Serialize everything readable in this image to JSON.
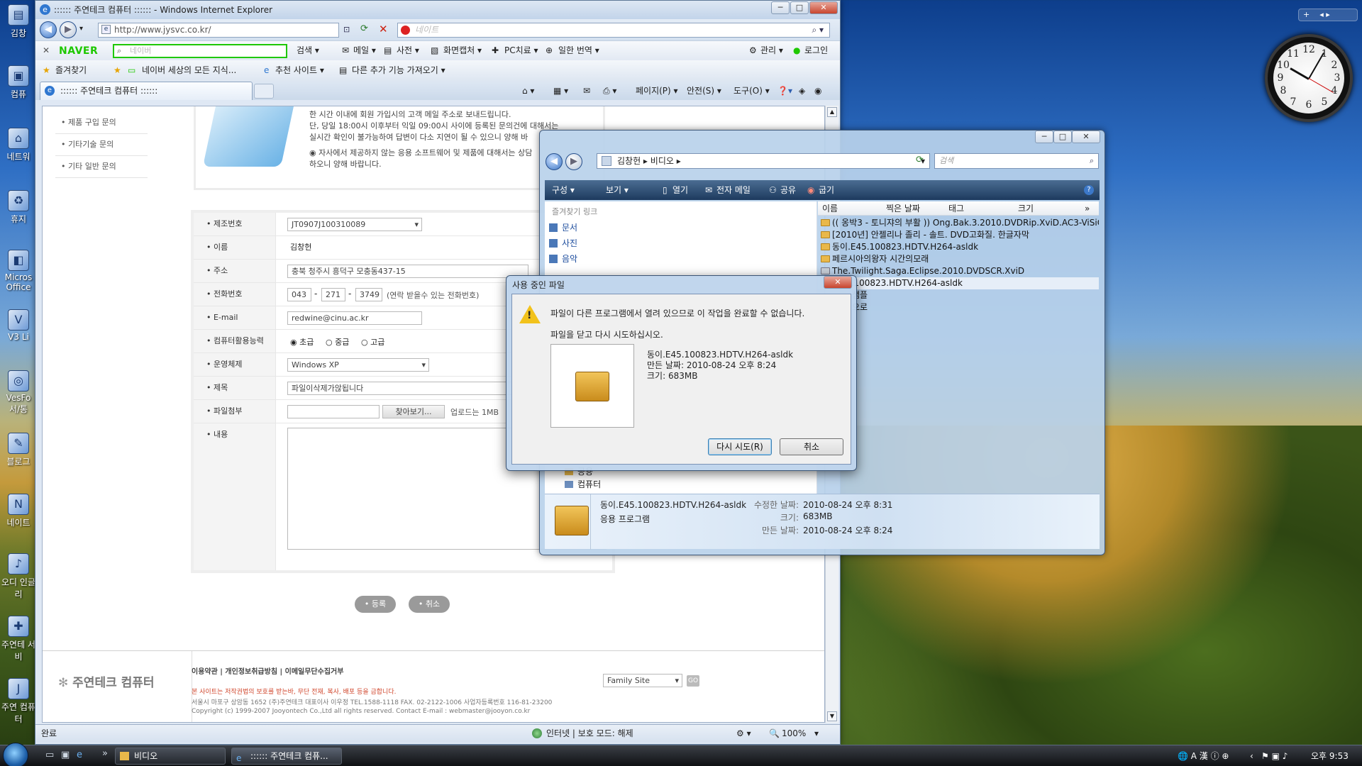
{
  "desktop": {
    "icons": [
      "김창",
      "컴퓨",
      "네트워",
      "휴지",
      "Micros Office",
      "V3 Li",
      "VesFo 서/통",
      "블로그",
      "네이트",
      "오디 인글리",
      "주연테 서비",
      "주연 컴퓨터"
    ]
  },
  "clock": {
    "numbers": [
      "12",
      "1",
      "2",
      "3",
      "4",
      "5",
      "6",
      "7",
      "8",
      "9",
      "10",
      "11"
    ]
  },
  "ie": {
    "title": ":::::: 주연테크 컴퓨터 :::::: - Windows Internet Explorer",
    "buttons": {
      "min": "─",
      "max": "□",
      "close": "✕"
    },
    "address": "http://www.jysvc.co.kr/",
    "search_placeholder": "네이트",
    "naver": {
      "logo": "NAVER",
      "placeholder": "네이버",
      "items": [
        "검색 ▾",
        "메일 ▾",
        "사전 ▾",
        "화면캡처 ▾",
        "PC치료 ▾",
        "일한 번역 ▾",
        "관리 ▾",
        "로그인"
      ]
    },
    "favorites": {
      "label": "즐겨찾기",
      "items": [
        "네이버 세상의 모든 지식...",
        "추천 사이트 ▾",
        "다른 추가 기능 가져오기 ▾"
      ]
    },
    "tab": ":::::: 주연테크 컴퓨터 ::::::",
    "commands": [
      "페이지(P) ▾",
      "안전(S) ▾",
      "도구(O) ▾"
    ],
    "status": {
      "left": "완료",
      "zone": "인터넷 | 보호 모드: 해제",
      "zoom": "100%"
    }
  },
  "page": {
    "left_nav": [
      "• 제품 구입 문의",
      "• 기타기술 문의",
      "• 기타 일반 문의"
    ],
    "notice": [
      "한 시간 이내에 회원 가입시의 고객 메일 주소로 보내드립니다.",
      "단, 당일 18:00시 이후부터 익일 09:00시 사이에 등록된 문의건에 대해서는",
      "실시간 확인이 불가능하여 답변이 다소 지연이 될 수 있으니 양해 바",
      "자사에서 제공하지 않는 응용 소프트웨어 및 제품에 대해서는 상담",
      "하오니 양해 바랍니다."
    ],
    "form": {
      "labels": [
        "• 제조번호",
        "• 이름",
        "• 주소",
        "• 전화번호",
        "• E-mail",
        "• 컴퓨터활용능력",
        "• 운영체제",
        "• 제목",
        "• 파일첨부",
        "• 내용"
      ],
      "serial": "JT0907J100310089",
      "name": "김창헌",
      "address": "충북 청주시 흥덕구 모충동437-15",
      "phone": [
        "043",
        "271",
        "3749"
      ],
      "phone_note": "(연락 받을수 있는 전화번호)",
      "email": "redwine@cinu.ac.kr",
      "skill": [
        "초급",
        "중급",
        "고급"
      ],
      "os": "Windows XP",
      "subject": "파일이삭제가않됩니다",
      "browse": "찾아보기...",
      "upload_note": "업로드는 1MB"
    },
    "buttons": {
      "submit": "• 등록",
      "cancel": "• 취소"
    },
    "footer": {
      "logo": "주연테크 컴퓨터",
      "links": "이용약관 | 개인정보취급방침 | 이메일무단수집거부",
      "warning": "본 사이트는 저작권법의 보호를 받는바, 무단 전재, 복사, 배포 등을 금합니다.",
      "address": "서울시 마포구 상암동 1652 (주)주연테크 대표이사 이우정 TEL.1588-1118 FAX. 02-2122-1006 사업자등록번호 116-81-23200",
      "copyright": "Copyright (c) 1999-2007 Jooyontech Co.,Ltd all rights reserved. Contact E-mail : webmaster@jooyon.co.kr",
      "family": "Family Site"
    }
  },
  "explorer": {
    "breadcrumb": "김창헌 ▸ 비디오 ▸",
    "search": "검색",
    "toolbar": [
      "구성 ▾",
      "보기 ▾",
      "열기",
      "전자 메일",
      "공유",
      "굽기"
    ],
    "fav_title": "즐겨찾기 링크",
    "favorites": [
      "문서",
      "사진",
      "음악"
    ],
    "tree": [
      "공용",
      "컴퓨터"
    ],
    "columns": [
      "이름",
      "찍은 날짜",
      "태그",
      "크기",
      "»"
    ],
    "files": [
      "(( 옹박3 - 토니쟈의 부활 )) Ong.Bak.3.2010.DVDRip.XviD.AC3-ViSiON",
      "[2010년] 안젤리나 졸리 - 솔트. DVD고화질. 한글자막",
      "동이.E45.100823.HDTV.H264-asldk",
      "페르시아의왕자 시간의모래",
      "The.Twilight.Saga.Eclipse.2010.DVDSCR.XviD",
      ".E45.100823.HDTV.H264-asldk",
      "샘플",
      "으로"
    ],
    "details": {
      "name": "동이.E45.100823.HDTV.H264-asldk",
      "type": "응용 프로그램",
      "modified_label": "수정한 날짜:",
      "modified": "2010-08-24 오후 8:31",
      "size_label": "크기:",
      "size": "683MB",
      "created_label": "만든 날짜:",
      "created": "2010-08-24 오후 8:24"
    }
  },
  "dialog": {
    "title": "사용 중인 파일",
    "message": "파일이 다른 프로그램에서 열려 있으므로 이 작업을 완료할 수 없습니다.",
    "hint": "파일을 닫고 다시 시도하십시오.",
    "file": "동이.E45.100823.HDTV.H264-asldk",
    "created": "만든 날짜: 2010-08-24 오후 8:24",
    "size": "크기: 683MB",
    "retry": "다시 시도(R)",
    "cancel": "취소"
  },
  "taskbar": {
    "items": [
      "비디오",
      ":::::: 주연테크 컴퓨..."
    ],
    "time": "오후 9:53"
  }
}
